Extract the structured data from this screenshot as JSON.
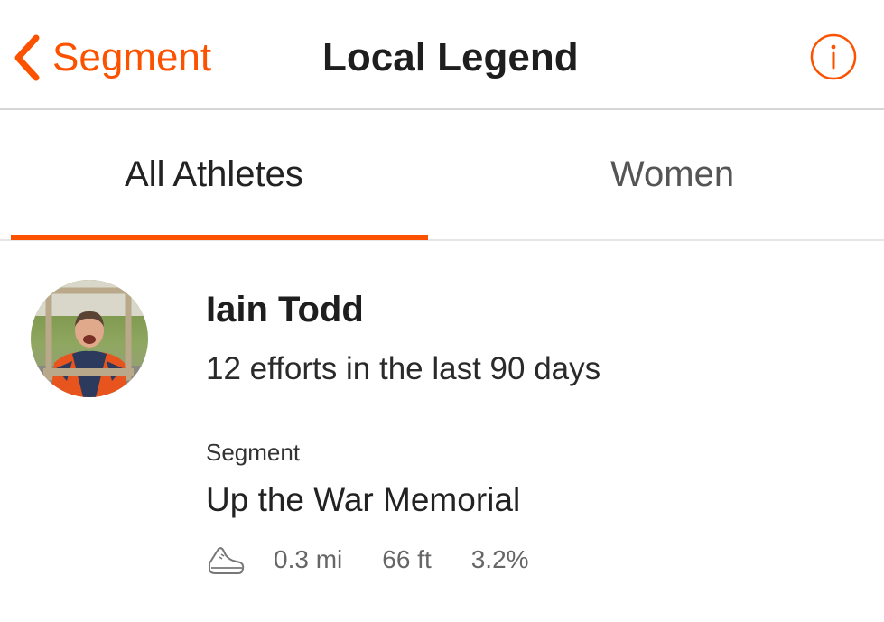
{
  "navbar": {
    "back_label": "Segment",
    "title": "Local Legend",
    "info_icon": "info-icon",
    "accent_color": "#fc5200"
  },
  "tabs": [
    {
      "label": "All Athletes",
      "selected": true
    },
    {
      "label": "Women",
      "selected": false
    }
  ],
  "legend": {
    "avatar_icon": "athlete-photo",
    "name": "Iain Todd",
    "efforts": "12 efforts in the last 90 days"
  },
  "segment": {
    "caption": "Segment",
    "name": "Up the War Memorial",
    "activity_icon": "running-shoe-icon",
    "distance": "0.3 mi",
    "elevation": "66 ft",
    "grade": "3.2%"
  }
}
